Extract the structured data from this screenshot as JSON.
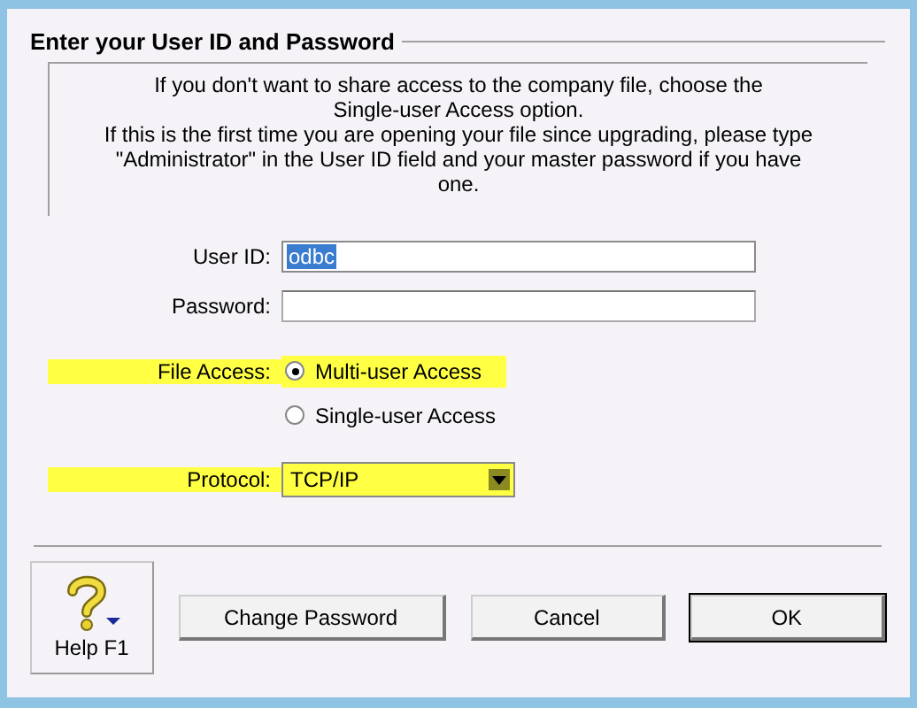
{
  "group_title": "Enter your User ID and Password",
  "info_lines": [
    "If you don't want to share access to the company file, choose the",
    "Single-user Access option.",
    "If this is the first time you are opening your file since upgrading, please type",
    "\"Administrator\" in the User ID field and your master password if you have",
    "one."
  ],
  "fields": [
    {
      "label": "User ID:",
      "value": "odbc",
      "text_selected": true
    },
    {
      "label": "Password:"
    }
  ],
  "file_access": {
    "label": "File Access:",
    "highlighted": true,
    "options": [
      {
        "label": "Multi-user Access",
        "selected": true,
        "highlighted": true
      },
      {
        "label": "Single-user Access",
        "selected": false,
        "highlighted": false
      }
    ]
  },
  "protocol": {
    "label": "Protocol:",
    "value": "TCP/IP",
    "highlighted": true
  },
  "help_button": {
    "label": "Help F1"
  },
  "buttons": [
    {
      "label": "Change Password",
      "default": false
    },
    {
      "label": "Cancel",
      "default": false
    },
    {
      "label": "OK",
      "default": true
    }
  ]
}
